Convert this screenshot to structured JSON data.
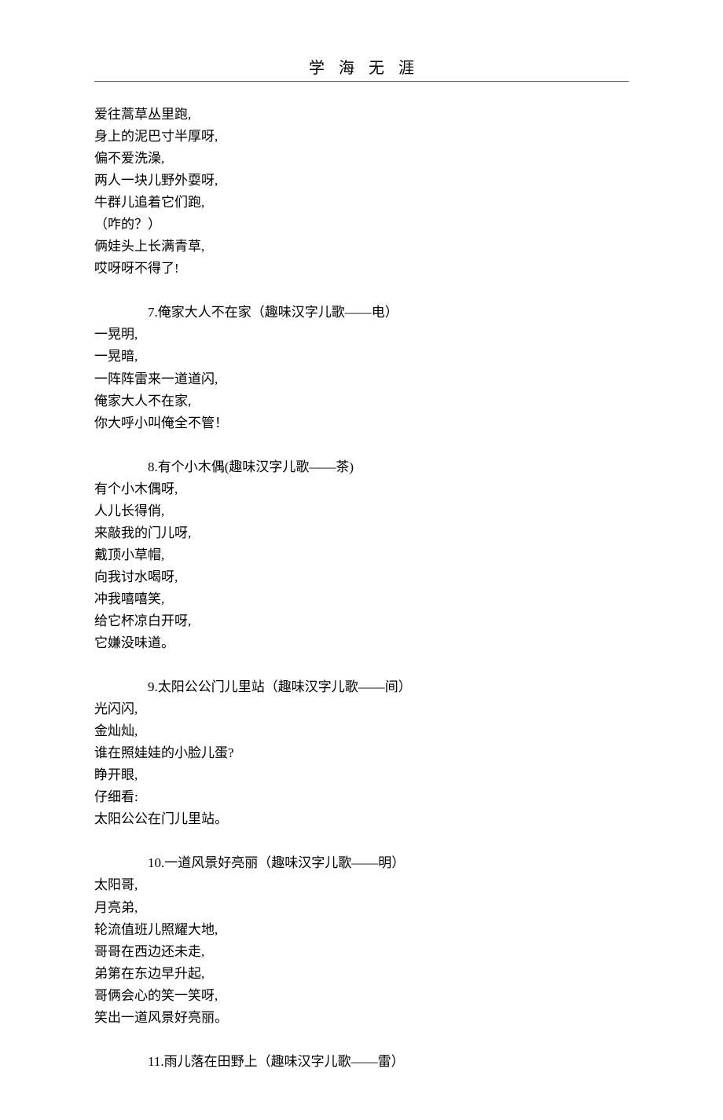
{
  "header": {
    "title": "学海无涯"
  },
  "intro": {
    "lines": [
      "爱往蒿草丛里跑,",
      "身上的泥巴寸半厚呀,",
      "偏不爱洗澡,",
      "两人一块儿野外耍呀,",
      "牛群儿追着它们跑,",
      "（咋的？）",
      "俩娃头上长满青草,",
      "哎呀呀不得了!"
    ]
  },
  "sections": [
    {
      "title": "7.俺家大人不在家（趣味汉字儿歌——电）",
      "lines": [
        "一晃明,",
        "一晃暗,",
        "一阵阵雷来一道道闪,",
        "俺家大人不在家,",
        "你大呼小叫俺全不管！"
      ]
    },
    {
      "title": "8.有个小木偶(趣味汉字儿歌——茶)",
      "lines": [
        "有个小木偶呀,",
        "人儿长得俏,",
        "来敲我的门儿呀,",
        "戴顶小草帽,",
        "向我讨水喝呀,",
        "冲我嘻嘻笑,",
        "给它杯凉白开呀,",
        "它嫌没味道。"
      ]
    },
    {
      "title": "9.太阳公公门儿里站（趣味汉字儿歌——间）",
      "lines": [
        "光闪闪,",
        "金灿灿,",
        "谁在照娃娃的小脸儿蛋?",
        "睁开眼,",
        "仔细看:",
        "太阳公公在门儿里站。"
      ]
    },
    {
      "title": "10.一道风景好亮丽（趣味汉字儿歌——明）",
      "lines": [
        "太阳哥,",
        "月亮弟,",
        "轮流值班儿照耀大地,",
        "哥哥在西边还未走,",
        "弟第在东边早升起,",
        "哥俩会心的笑一笑呀,",
        "笑出一道风景好亮丽。"
      ]
    },
    {
      "title": "11.雨儿落在田野上（趣味汉字儿歌——雷）",
      "lines": []
    }
  ]
}
